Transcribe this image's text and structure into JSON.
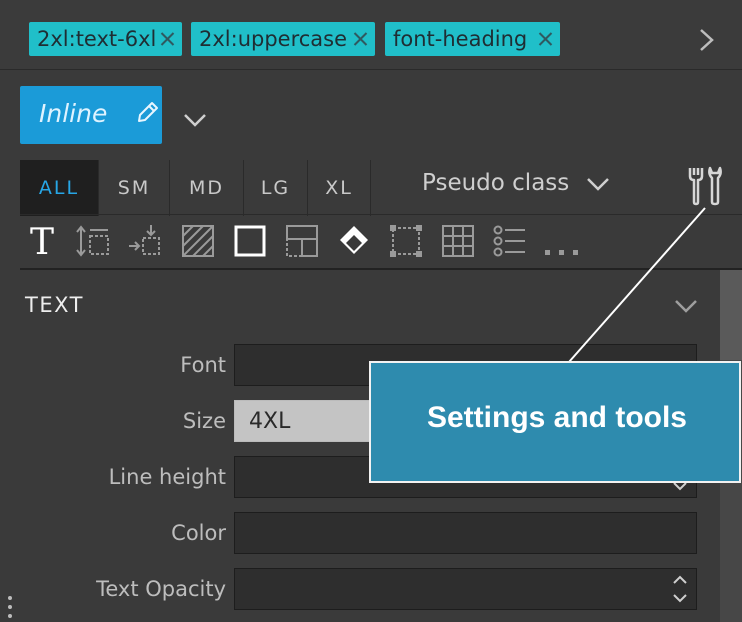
{
  "tags": [
    {
      "label": "2xl:text-6xl"
    },
    {
      "label": "2xl:uppercase"
    },
    {
      "label": "font-heading"
    }
  ],
  "mode_button": {
    "label": "Inline",
    "icon": "pencil-icon"
  },
  "breakpoints": [
    "ALL",
    "SM",
    "MD",
    "LG",
    "XL"
  ],
  "active_breakpoint": "ALL",
  "pseudo_class": {
    "label": "Pseudo class"
  },
  "toolbar_icons": [
    "text-icon",
    "vertical-spacing-icon",
    "align-icon",
    "background-pattern-icon",
    "border-icon",
    "layout-icon",
    "fill-icon",
    "padding-icon",
    "grid-icon",
    "list-icon",
    "more-icon"
  ],
  "section": {
    "title": "TEXT"
  },
  "fields": [
    {
      "label": "Font",
      "value": ""
    },
    {
      "label": "Size",
      "value": "4XL"
    },
    {
      "label": "Line height",
      "value": ""
    },
    {
      "label": "Color",
      "value": ""
    },
    {
      "label": "Text Opacity",
      "value": ""
    }
  ],
  "callout": {
    "text": "Settings and tools"
  },
  "colors": {
    "tag_bg": "#20bfc9",
    "accent_blue": "#1b9bd8",
    "active_tab_text": "#27a6e6",
    "callout_bg": "#2e8bae",
    "panel_bg": "#3a3a3a"
  }
}
